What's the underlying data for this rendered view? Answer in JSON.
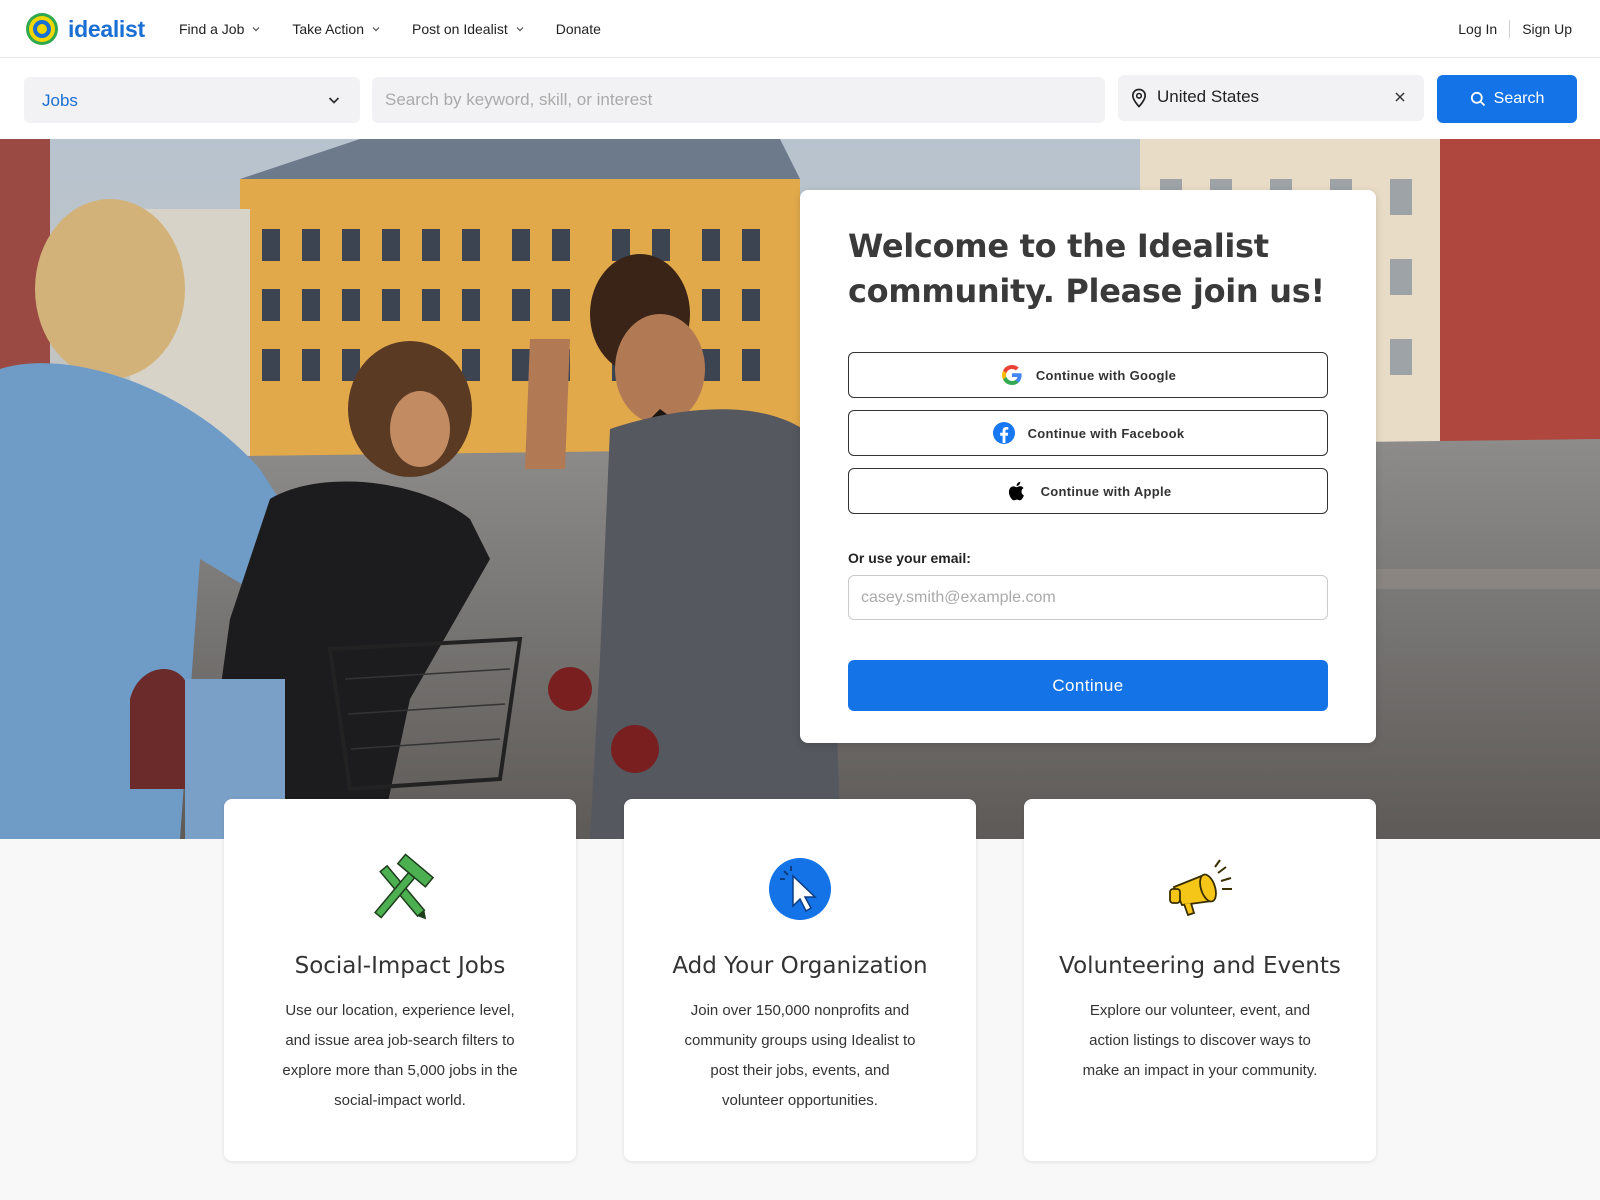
{
  "brand": {
    "name": "idealist"
  },
  "nav": {
    "items": [
      {
        "label": "Find a Job"
      },
      {
        "label": "Take Action"
      },
      {
        "label": "Post on Idealist"
      },
      {
        "label": "Donate"
      }
    ],
    "login": "Log In",
    "signup": "Sign Up"
  },
  "search": {
    "type_selected": "Jobs",
    "keyword_placeholder": "Search by keyword, skill, or interest",
    "location_value": "United States",
    "button_label": "Search"
  },
  "signup_card": {
    "title": "Welcome to the Idealist community. Please join us!",
    "google_label": "Continue with Google",
    "facebook_label": "Continue with Facebook",
    "apple_label": "Continue with Apple",
    "email_label": "Or use your email:",
    "email_placeholder": "casey.smith@example.com",
    "continue_label": "Continue"
  },
  "features": [
    {
      "title": "Social-Impact Jobs",
      "text": "Use our location, experience level, and issue area job-search filters to explore more than 5,000 jobs in the social-impact world."
    },
    {
      "title": "Add Your Organization",
      "text": "Join over 150,000 nonprofits and community groups using Idealist to post their jobs, events, and volunteer opportunities."
    },
    {
      "title": "Volunteering and Events",
      "text": "Explore our volunteer, event, and action listings to discover ways to make an impact in your community."
    }
  ],
  "colors": {
    "accent": "#1473e6",
    "brand": "#1a6fd4"
  }
}
